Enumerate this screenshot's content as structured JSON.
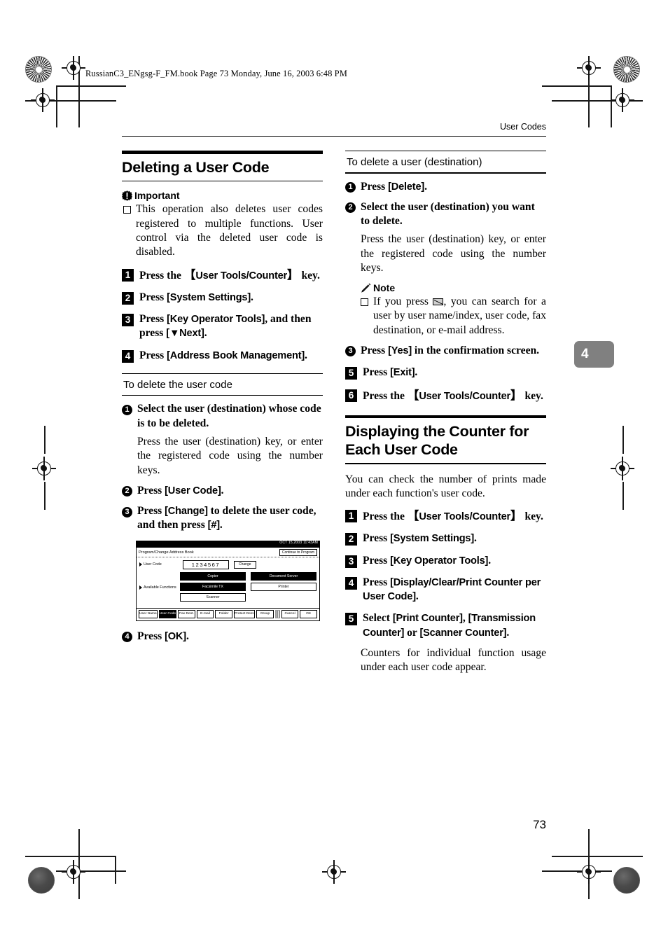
{
  "file_header": "RussianC3_ENgsg-F_FM.book  Page 73  Monday, June 16, 2003  6:48 PM",
  "running_head": "User Codes",
  "page_number": "73",
  "chapter_tab": "4",
  "left_column": {
    "heading": "Deleting a User Code",
    "important": {
      "label": "Important",
      "icon": "important-icon",
      "bullets": [
        "This operation also deletes user codes registered to multiple functions. User control via the deleted user code is disabled."
      ]
    },
    "steps": [
      {
        "num": "1",
        "pre": "Press the ",
        "key": "User Tools/Counter",
        "post": " key."
      },
      {
        "num": "2",
        "pre": "Press ",
        "ui": "[System Settings]",
        "post": "."
      },
      {
        "num": "3",
        "pre": "Press ",
        "ui": "[Key Operator Tools]",
        "mid": ", and then press ",
        "ui2": "[▼Next]",
        "post": "."
      },
      {
        "num": "4",
        "pre": "Press ",
        "ui": "[Address Book Management]",
        "post": "."
      }
    ],
    "subsection": {
      "heading": "To delete the user code",
      "substeps": [
        {
          "num": "1",
          "bold": "Select the user (destination) whose code is to be deleted.",
          "body": "Press the user (destination) key, or enter the registered code using the number keys."
        },
        {
          "num": "2",
          "pre": "Press ",
          "ui": "[User Code]",
          "post": "."
        },
        {
          "num": "3",
          "pre": "Press ",
          "ui": "[Change]",
          "mid": " to delete the user code, and then press ",
          "ui2": "[#]",
          "post": "."
        },
        {
          "num": "4",
          "pre": "Press ",
          "ui": "[OK]",
          "post": "."
        }
      ]
    }
  },
  "lcd_figure": {
    "name": "program-change-address-book-screen",
    "clock": "OCT  15,2003  11:43AM",
    "title": "Program/Change Address Book",
    "continue_button": "Continue to Program",
    "user_code_label": "User Code",
    "user_code_value": "1234567",
    "change_button": "Change",
    "available_functions_label": "Available Functions",
    "functions": [
      {
        "label": "Copier",
        "selected": true
      },
      {
        "label": "Document Server",
        "selected": true
      },
      {
        "label": "Facsimile TX",
        "selected": true
      },
      {
        "label": "Printer",
        "selected": false
      },
      {
        "label": "Scanner",
        "selected": false
      }
    ],
    "tabs": [
      {
        "label": "User Name",
        "selected": false
      },
      {
        "label": "User Code",
        "selected": true
      },
      {
        "label": "Fax Dest.",
        "selected": false
      },
      {
        "label": "E-mail",
        "selected": false
      },
      {
        "label": "Folder",
        "selected": false
      },
      {
        "label": "Protect Dest.",
        "selected": false
      },
      {
        "label": "Group",
        "selected": false
      }
    ],
    "cancel_button": "Cancel",
    "ok_button": "OK"
  },
  "right_column": {
    "subsection": {
      "heading": "To delete a user (destination)",
      "substeps": [
        {
          "num": "1",
          "pre": "Press ",
          "ui": "[Delete]",
          "post": "."
        },
        {
          "num": "2",
          "bold": "Select the user (destination) you want to delete.",
          "body": "Press the user (destination) key, or enter the registered code using the number keys."
        },
        {
          "num": "3",
          "pre": "Press ",
          "ui": "[Yes]",
          "mid": " in the confirmation screen.",
          "post": ""
        }
      ],
      "note": {
        "label": "Note",
        "icon": "note-pencil-icon",
        "bullet_pre": "If you press ",
        "bullet_icon": "envelope-search-icon",
        "bullet_post": ", you can search for a user by user name/index, user code, fax destination, or e-mail address."
      }
    },
    "steps_tail": [
      {
        "num": "5",
        "pre": "Press ",
        "ui": "[Exit]",
        "post": "."
      },
      {
        "num": "6",
        "pre": "Press the ",
        "key": "User Tools/Counter",
        "post": " key."
      }
    ],
    "heading2": "Displaying the Counter for Each User Code",
    "intro": "You can check the number of prints made under each function's user code.",
    "steps2": [
      {
        "num": "1",
        "pre": "Press the ",
        "key": "User Tools/Counter",
        "post": " key."
      },
      {
        "num": "2",
        "pre": "Press ",
        "ui": "[System Settings]",
        "post": "."
      },
      {
        "num": "3",
        "pre": "Press ",
        "ui": "[Key Operator Tools]",
        "post": "."
      },
      {
        "num": "4",
        "pre": "Press ",
        "ui": "[Display/Clear/Print Counter per User Code]",
        "post": "."
      },
      {
        "num": "5",
        "pre": "Select ",
        "ui": "[Print Counter]",
        "mid": ", ",
        "ui2": "[Transmission Counter]",
        "mid2": " or ",
        "ui3": "[Scanner Counter]",
        "post": "."
      }
    ],
    "outro": "Counters for individual function usage under each user code appear."
  }
}
